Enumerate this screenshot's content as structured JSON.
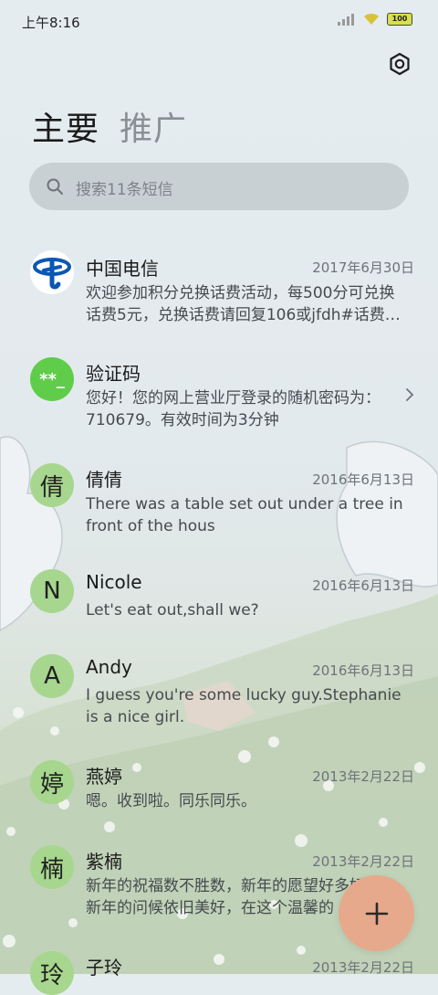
{
  "status_bar": {
    "time": "上午8:16",
    "battery": "100"
  },
  "tabs": [
    {
      "label": "主要",
      "active": true
    },
    {
      "label": "推广",
      "active": false
    }
  ],
  "search": {
    "placeholder": "搜索11条短信"
  },
  "conversations": [
    {
      "name": "中国电信",
      "date": "2017年6月30日",
      "preview": "欢迎参加积分兑换话费活动，每500分可兑换话费5元，兑换话费请回复106或jfdh#话费…",
      "avatar": "telecom-logo-icon"
    },
    {
      "name": "验证码",
      "date": "",
      "preview": "您好！您的网上营业厅登录的随机密码为：710679。有效时间为3分钟",
      "avatar_text": "**_"
    },
    {
      "name": "倩倩",
      "date": "2016年6月13日",
      "preview": "There was a table set out under a tree in front of the hous",
      "avatar_text": "倩"
    },
    {
      "name": "Nicole",
      "date": "2016年6月13日",
      "preview": "Let's eat out,shall we?",
      "avatar_text": "N"
    },
    {
      "name": "Andy",
      "date": "2016年6月13日",
      "preview": "I guess you're some lucky guy.Stephanie is a nice girl.",
      "avatar_text": "A"
    },
    {
      "name": "燕婷",
      "date": "2013年2月22日",
      "preview": "嗯。收到啦。同乐同乐。",
      "avatar_text": "婷"
    },
    {
      "name": "紫楠",
      "date": "2013年2月22日",
      "preview": "新年的祝福数不胜数，新年的愿望好多好多，新年的问候依旧美好，在这个温馨的",
      "avatar_text": "楠"
    },
    {
      "name": "子玲",
      "date": "2013年2月22日",
      "preview": "",
      "avatar_text": "玲"
    }
  ],
  "colors": {
    "fab": "#e7a98b",
    "avatar": "#a7d68e",
    "code_avatar": "#5fcd4a",
    "telecom_blue": "#0a57b5"
  }
}
